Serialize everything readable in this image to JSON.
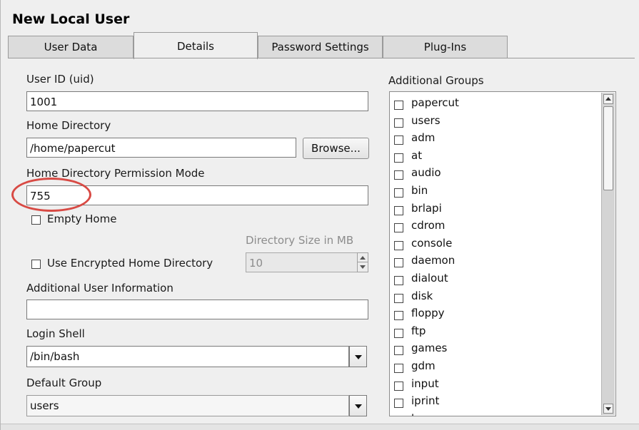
{
  "window": {
    "title": "New Local User"
  },
  "tabs": [
    {
      "label": "User Data",
      "active": false
    },
    {
      "label": "Details",
      "active": true
    },
    {
      "label": "Password Settings",
      "active": false
    },
    {
      "label": "Plug-Ins",
      "active": false
    }
  ],
  "user_id": {
    "label": "User ID (uid)",
    "value": "1001"
  },
  "home_directory": {
    "label": "Home Directory",
    "value": "/home/papercut",
    "browse_label": "Browse..."
  },
  "permission_mode": {
    "label": "Home Directory Permission Mode",
    "value": "755"
  },
  "empty_home": {
    "label": "Empty Home",
    "checked": false
  },
  "directory_size": {
    "label": "Directory Size in MB",
    "value": "10",
    "enabled": false
  },
  "encrypted_home": {
    "label": "Use Encrypted Home Directory",
    "checked": false
  },
  "additional_info": {
    "label": "Additional User Information",
    "value": ""
  },
  "login_shell": {
    "label": "Login Shell",
    "value": "/bin/bash"
  },
  "default_group": {
    "label": "Default Group",
    "value": "users"
  },
  "additional_groups": {
    "label": "Additional Groups",
    "items": [
      "papercut",
      "users",
      "adm",
      "at",
      "audio",
      "bin",
      "brlapi",
      "cdrom",
      "console",
      "daemon",
      "dialout",
      "disk",
      "floppy",
      "ftp",
      "games",
      "gdm",
      "input",
      "iprint",
      "kmem"
    ]
  },
  "colors": {
    "highlight_ring": "#d84a44",
    "window_bg": "#efefef"
  }
}
